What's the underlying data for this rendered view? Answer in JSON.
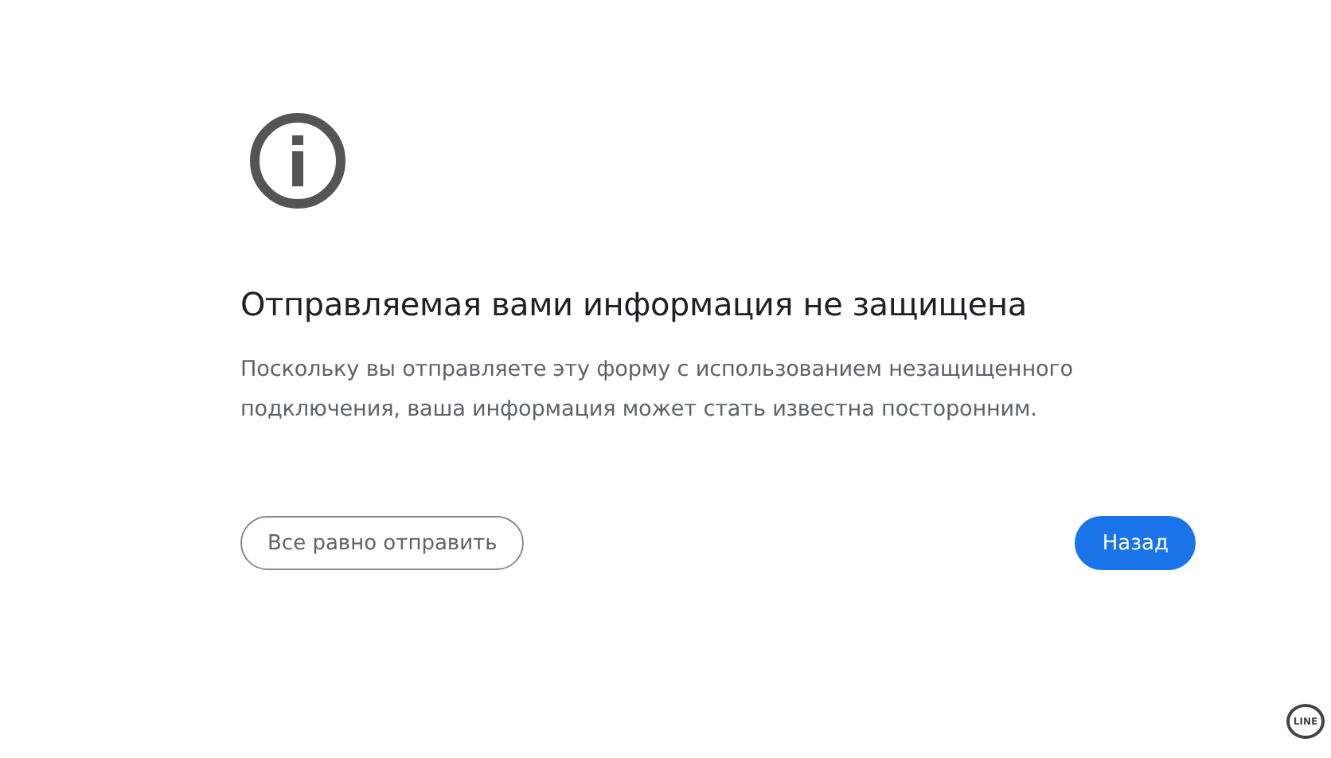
{
  "title": "Отправляемая вами информация не защищена",
  "message": "Поскольку вы отправляете эту форму с использованием незащищенного подключения, ваша информация может стать известна посторонним.",
  "buttons": [
    {
      "label": "Все равно отправить",
      "kind": "secondary"
    },
    {
      "label": "Назад",
      "kind": "primary"
    }
  ],
  "corner_badge": {
    "label": "LINE"
  }
}
